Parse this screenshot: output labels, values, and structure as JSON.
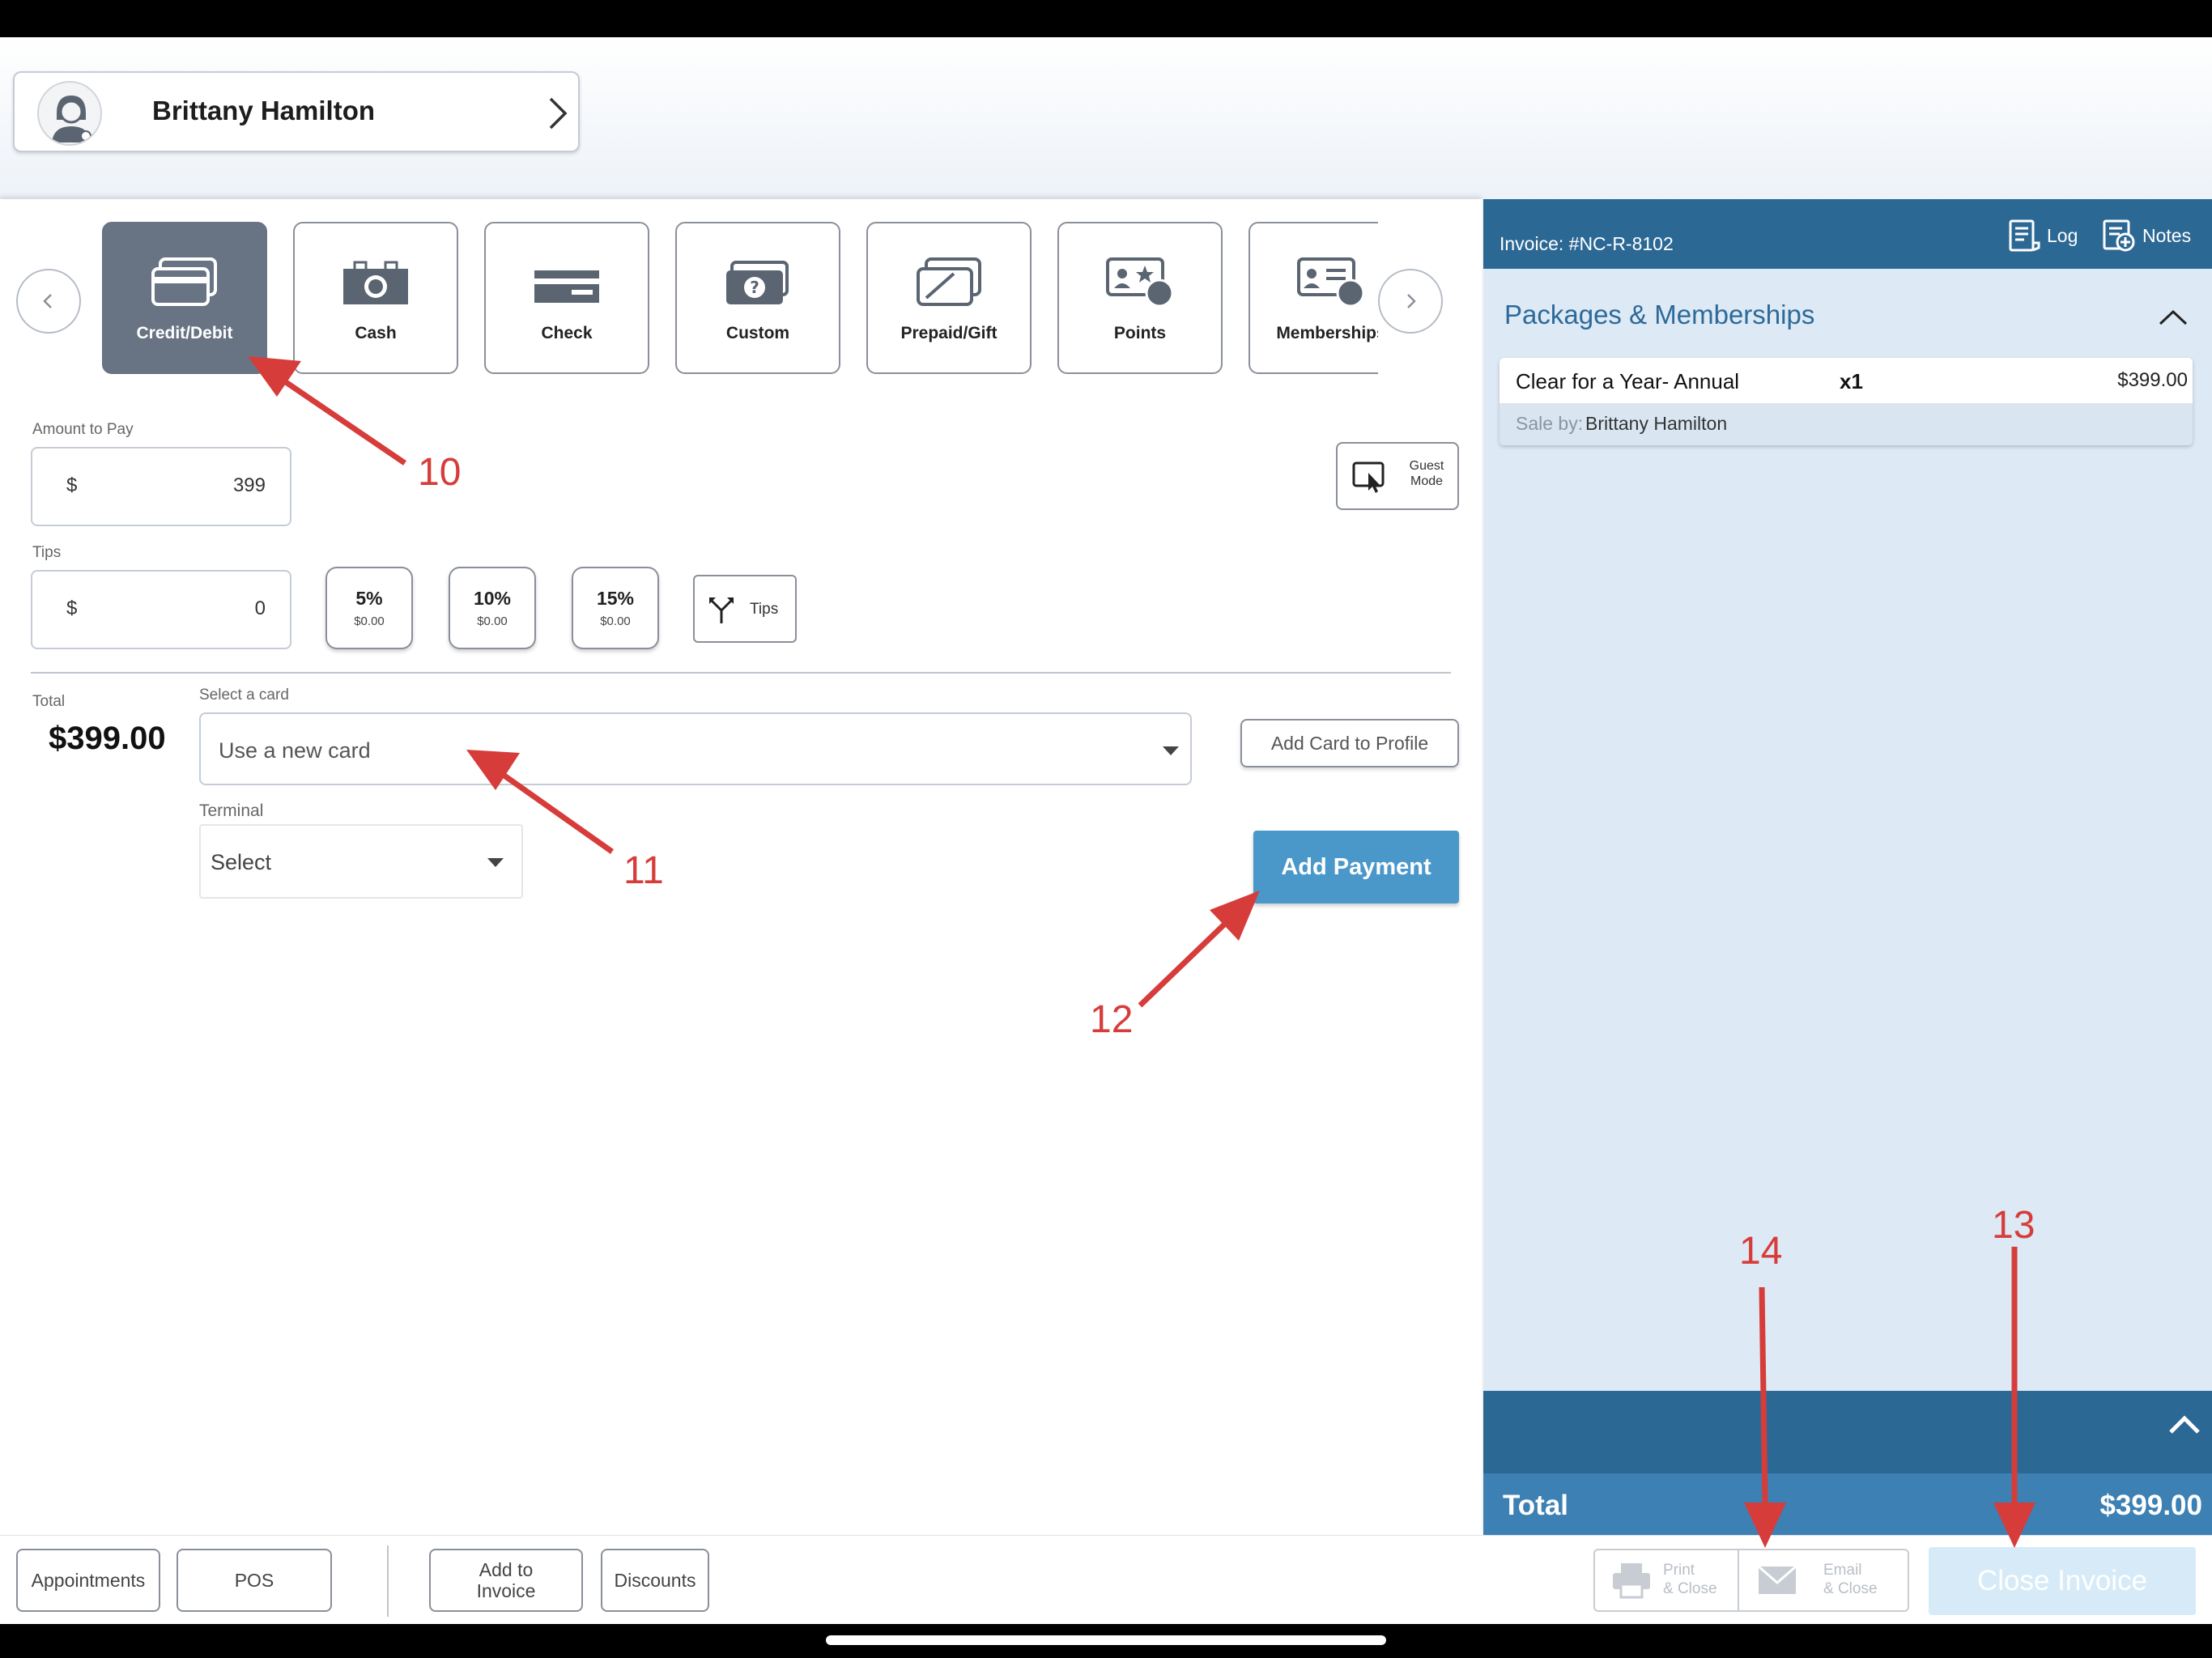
{
  "client": {
    "name": "Brittany Hamilton"
  },
  "payment_methods": [
    {
      "label": "Credit/Debit",
      "icon": "credit-card-icon",
      "selected": true
    },
    {
      "label": "Cash",
      "icon": "cash-icon",
      "selected": false
    },
    {
      "label": "Check",
      "icon": "check-icon",
      "selected": false
    },
    {
      "label": "Custom",
      "icon": "custom-payment-icon",
      "selected": false
    },
    {
      "label": "Prepaid/Gift",
      "icon": "gift-card-icon",
      "selected": false
    },
    {
      "label": "Points",
      "icon": "points-icon",
      "selected": false
    },
    {
      "label": "Memberships",
      "icon": "membership-card-icon",
      "selected": false
    }
  ],
  "amount": {
    "label": "Amount to Pay",
    "currency": "$",
    "value": "399"
  },
  "guest_mode": {
    "line1": "Guest",
    "line2": "Mode"
  },
  "tips": {
    "label": "Tips",
    "currency": "$",
    "value": "0",
    "presets": [
      {
        "percent": "5%",
        "amount": "$0.00"
      },
      {
        "percent": "10%",
        "amount": "$0.00"
      },
      {
        "percent": "15%",
        "amount": "$0.00"
      }
    ],
    "split_label": "Tips"
  },
  "total": {
    "label": "Total",
    "value": "$399.00"
  },
  "card_select": {
    "label": "Select a card",
    "value": "Use a new card"
  },
  "add_card_label": "Add Card to Profile",
  "terminal": {
    "label": "Terminal",
    "value": "Select"
  },
  "add_payment_label": "Add Payment",
  "invoice": {
    "title": "Invoice: #NC-R-8102",
    "log_label": "Log",
    "notes_label": "Notes",
    "section_title": "Packages & Memberships",
    "item": {
      "name": "Clear for a Year- Annual",
      "qty": "x1",
      "price": "$399.00",
      "sale_by_label": "Sale by:",
      "sale_by": "Brittany Hamilton"
    },
    "total_label": "Total",
    "total_value": "$399.00"
  },
  "bottom_nav": {
    "appointments": "Appointments",
    "pos": "POS",
    "add_to_invoice_1": "Add to",
    "add_to_invoice_2": "Invoice",
    "discounts": "Discounts",
    "print_1": "Print",
    "print_2": "& Close",
    "email_1": "Email",
    "email_2": "& Close",
    "close_invoice": "Close Invoice"
  },
  "annotations": [
    "10",
    "11",
    "12",
    "13",
    "14"
  ],
  "colors": {
    "accent": "#2c6894",
    "selected_tile": "#687483",
    "add_payment": "#4a98c9",
    "annotation": "#d63c3a"
  }
}
